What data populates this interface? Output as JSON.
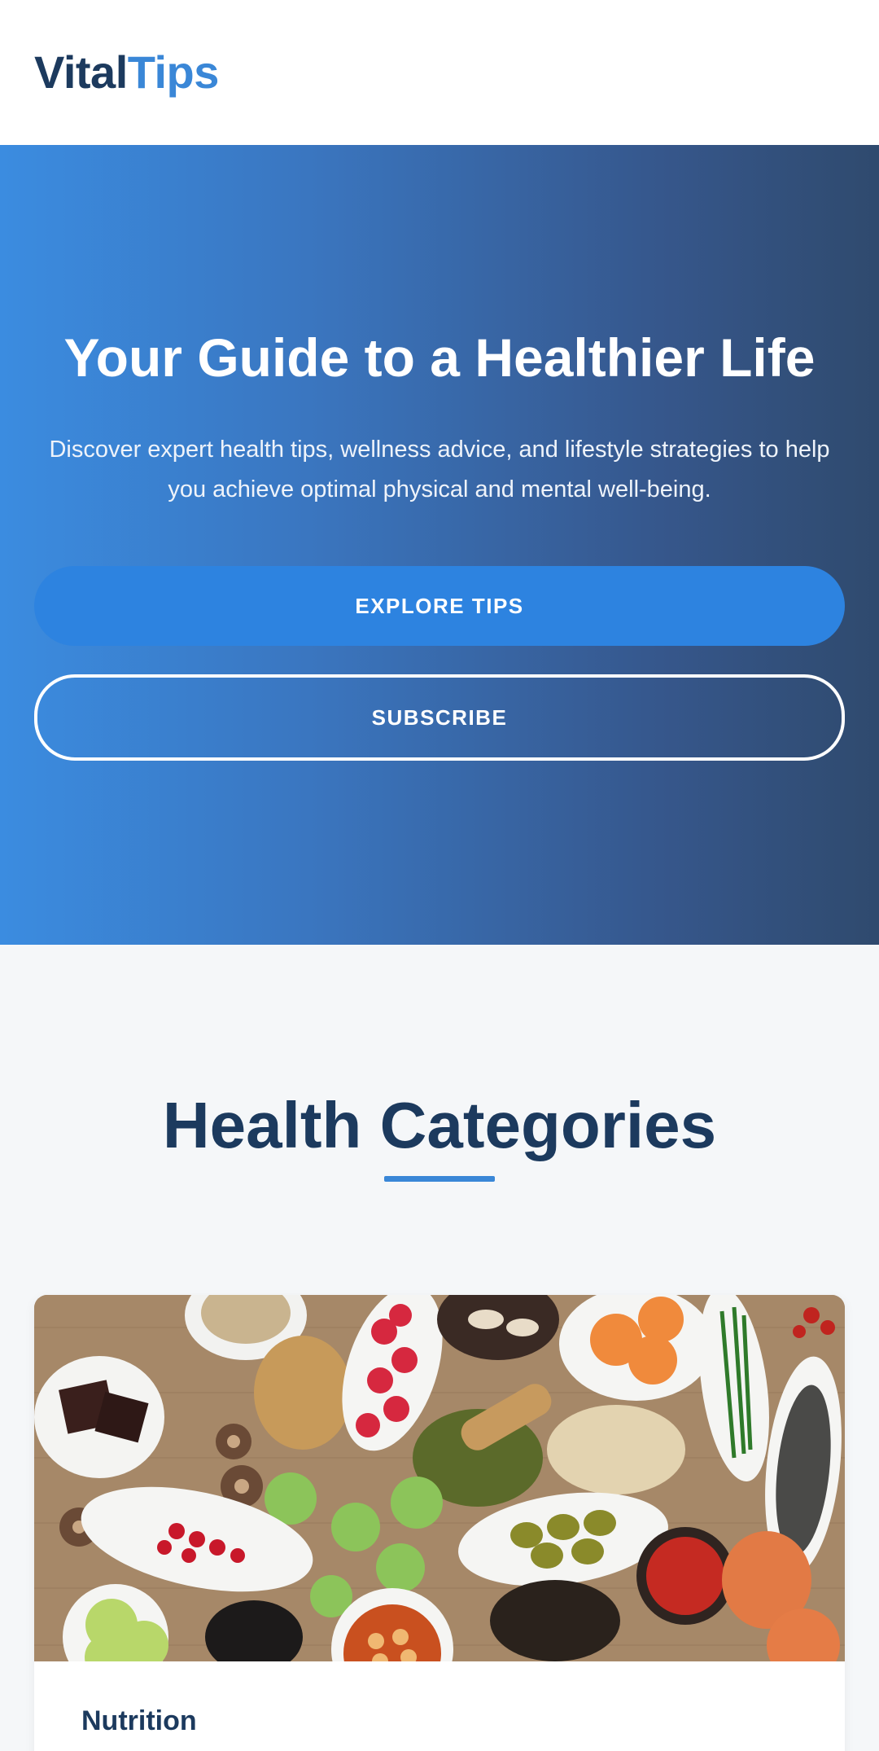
{
  "header": {
    "logo_part1": "Vital",
    "logo_part2": "Tips"
  },
  "hero": {
    "title": "Your Guide to a Healthier Life",
    "description": "Discover expert health tips, wellness advice, and lifestyle strategies to help you achieve optimal physical and mental well-being.",
    "primary_button": "EXPLORE TIPS",
    "secondary_button": "SUBSCRIBE"
  },
  "categories": {
    "heading": "Health Categories",
    "cards": [
      {
        "title": "Nutrition",
        "image": "healthy-foods-photo"
      }
    ]
  },
  "colors": {
    "brand_dark": "#1c3a5e",
    "brand_accent": "#3a87d7",
    "button_primary": "#2d83e0",
    "page_background": "#f5f7f9"
  }
}
